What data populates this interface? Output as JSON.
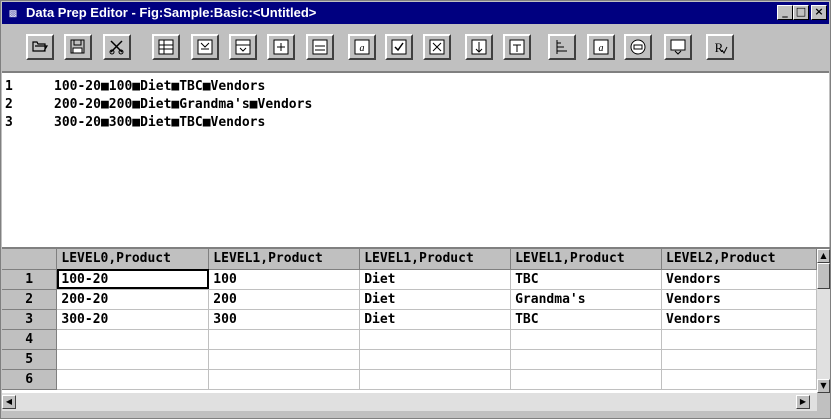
{
  "window": {
    "title": "Data Prep Editor - Fig:Sample:Basic:<Untitled>",
    "icon": "app-icon",
    "controls": {
      "minimize": "_",
      "maximize": "□",
      "close": "×"
    }
  },
  "toolbar": {
    "buttons": [
      {
        "name": "open-icon"
      },
      {
        "name": "save-icon"
      },
      {
        "name": "cut-icon"
      },
      {
        "name": "dim-build-icon"
      },
      {
        "name": "dim-build-2-icon"
      },
      {
        "name": "field-props-icon"
      },
      {
        "name": "add-field-icon"
      },
      {
        "name": "add-text-icon"
      },
      {
        "name": "text-icon"
      },
      {
        "name": "select-icon"
      },
      {
        "name": "reject-icon"
      },
      {
        "name": "move-field-icon"
      },
      {
        "name": "split-field-icon"
      },
      {
        "name": "join-field-icon"
      },
      {
        "name": "outline-icon"
      },
      {
        "name": "preview-icon"
      },
      {
        "name": "record-icon"
      },
      {
        "name": "rules-icon"
      }
    ]
  },
  "data_lines": [
    {
      "num": "1",
      "text": "100-20■100■Diet■TBC■Vendors"
    },
    {
      "num": "2",
      "text": "200-20■200■Diet■Grandma's■Vendors"
    },
    {
      "num": "3",
      "text": "300-20■300■Diet■TBC■Vendors"
    }
  ],
  "grid": {
    "headers": [
      "LEVEL0,Product",
      "LEVEL1,Product",
      "LEVEL1,Product",
      "LEVEL1,Product",
      "LEVEL2,Product"
    ],
    "rows": [
      {
        "num": "1",
        "cells": [
          "100-20",
          "100",
          "Diet",
          "TBC",
          "Vendors"
        ]
      },
      {
        "num": "2",
        "cells": [
          "200-20",
          "200",
          "Diet",
          "Grandma's",
          "Vendors"
        ]
      },
      {
        "num": "3",
        "cells": [
          "300-20",
          "300",
          "Diet",
          "TBC",
          "Vendors"
        ]
      },
      {
        "num": "4",
        "cells": [
          "",
          "",
          "",
          "",
          ""
        ]
      },
      {
        "num": "5",
        "cells": [
          "",
          "",
          "",
          "",
          ""
        ]
      },
      {
        "num": "6",
        "cells": [
          "",
          "",
          "",
          "",
          ""
        ]
      }
    ]
  },
  "scroll": {
    "up": "▲",
    "down": "▼",
    "left": "◀",
    "right": "▶"
  }
}
